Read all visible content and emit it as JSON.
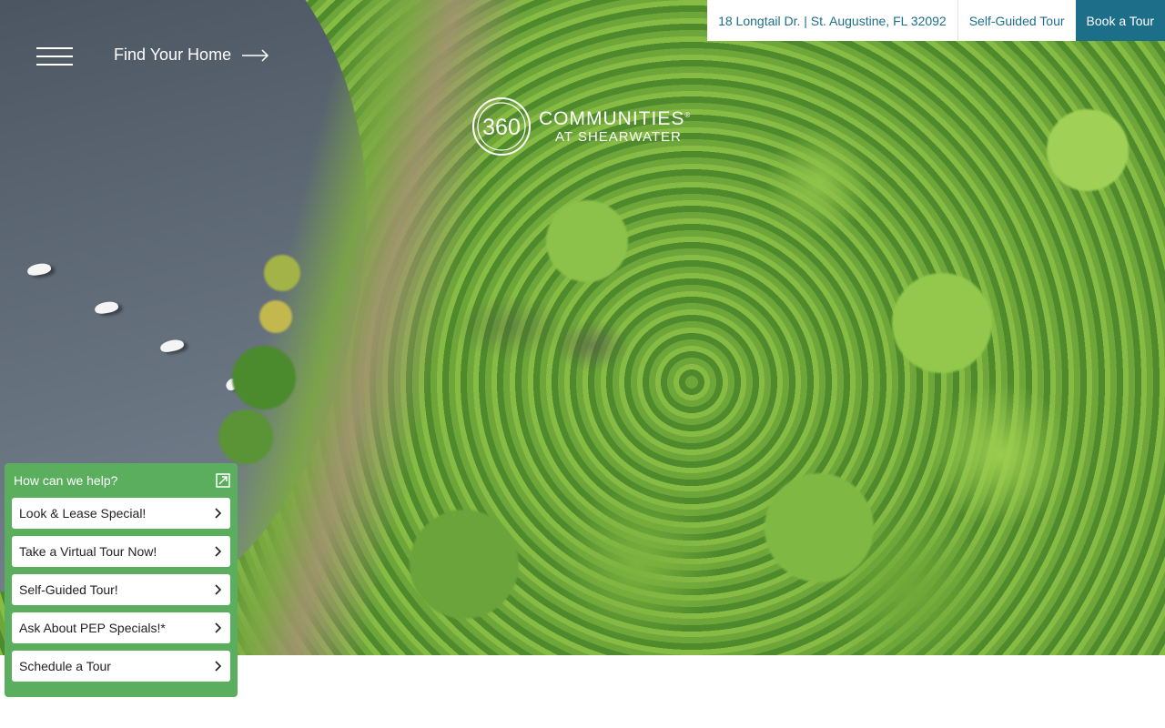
{
  "header": {
    "find_home_label": "Find Your Home",
    "address": "18 Longtail Dr. | St. Augustine, FL 32092",
    "self_guided_label": "Self-Guided Tour",
    "book_tour_label": "Book a Tour"
  },
  "logo": {
    "mark": "360",
    "line1": "COMMUNITIES",
    "registered": "®",
    "line2": "AT SHEARWATER"
  },
  "help_widget": {
    "title": "How can we help?",
    "items": [
      {
        "label": "Look & Lease Special!"
      },
      {
        "label": "Take a Virtual Tour Now!"
      },
      {
        "label": "Self-Guided Tour!"
      },
      {
        "label": "Ask About PEP Specials!*"
      },
      {
        "label": "Schedule a Tour"
      }
    ]
  },
  "colors": {
    "brand_teal": "#1c6e89",
    "widget_green": "#5aae5e"
  },
  "icons": [
    "hamburger-menu-icon",
    "arrow-right-icon",
    "expand-icon",
    "chevron-right-icon"
  ]
}
